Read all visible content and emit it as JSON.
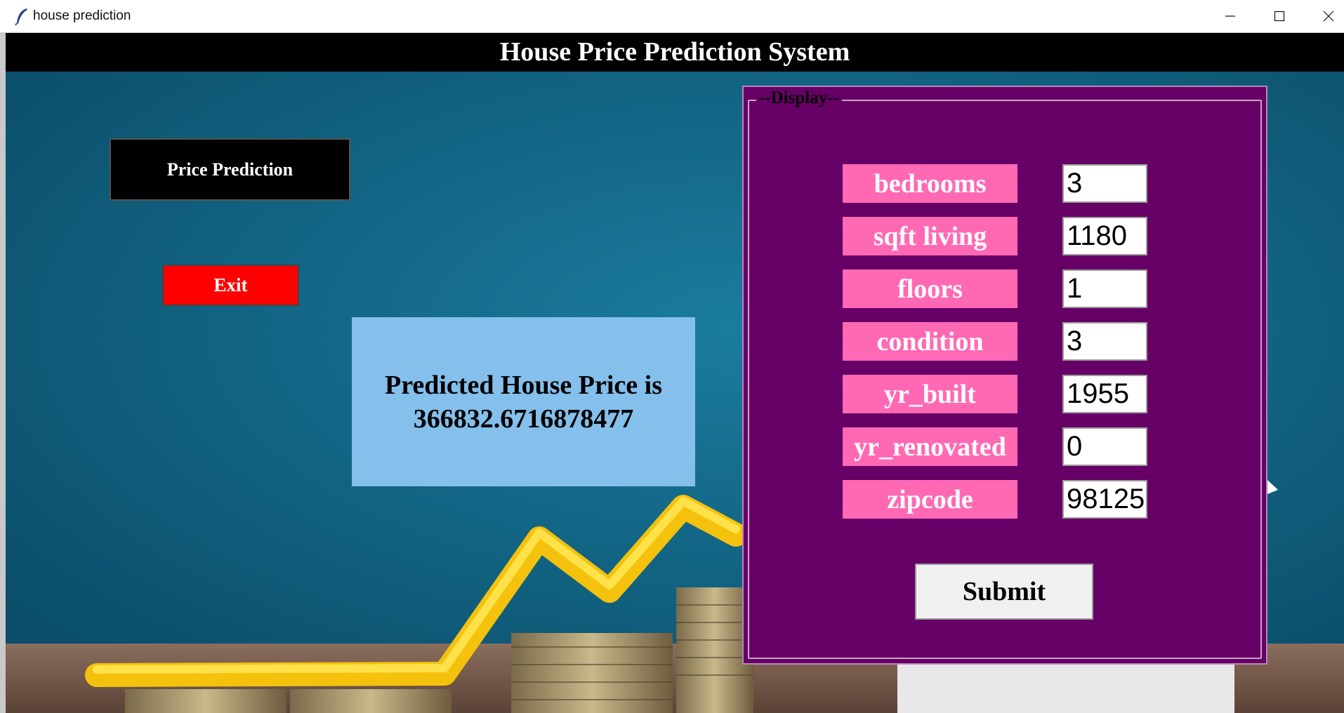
{
  "window": {
    "title": "house prediction",
    "app_icon": "feather-icon",
    "controls": [
      "minimize-icon",
      "maximize-icon",
      "close-icon"
    ]
  },
  "header": {
    "title": "House Price Prediction System"
  },
  "left_buttons": {
    "price_prediction": "Price Prediction",
    "exit": "Exit"
  },
  "result": {
    "line1": "Predicted House Price is",
    "line2": "366832.6716878477"
  },
  "display_panel": {
    "legend": "--Display--",
    "fields": [
      {
        "label": "bedrooms",
        "value": "3"
      },
      {
        "label": "sqft living",
        "value": "1180"
      },
      {
        "label": "floors",
        "value": "1"
      },
      {
        "label": "condition",
        "value": "3"
      },
      {
        "label": "yr_built",
        "value": "1955"
      },
      {
        "label": "yr_renovated",
        "value": "0"
      },
      {
        "label": "zipcode",
        "value": "98125"
      }
    ],
    "submit_label": "Submit"
  },
  "colors": {
    "header_bg": "#000000",
    "background": "#0c5f7d",
    "panel_bg": "#660066",
    "label_bg": "#ff69b4",
    "result_bg": "#85bfeb",
    "exit_bg": "#ff0000"
  }
}
